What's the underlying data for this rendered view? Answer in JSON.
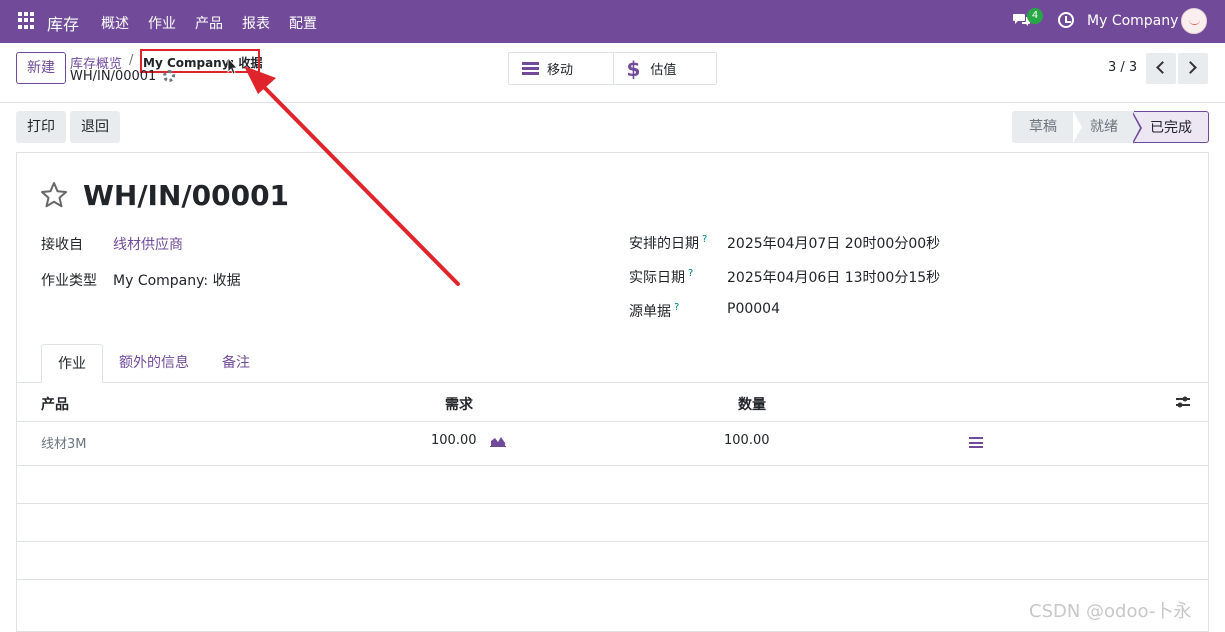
{
  "navbar": {
    "app_name": "库存",
    "menu": [
      "概述",
      "作业",
      "产品",
      "报表",
      "配置"
    ],
    "chat_badge": "4",
    "company": "My Company"
  },
  "control": {
    "new_label": "新建",
    "breadcrumb_parent": "库存概览",
    "breadcrumb_sep": "/",
    "breadcrumb_current": "My Company: 收据",
    "record_name": "WH/IN/00001",
    "smart_buttons": [
      {
        "label": "移动",
        "icon": "menu-lines-icon"
      },
      {
        "label": "估值",
        "icon": "dollar-icon"
      }
    ],
    "pager": "3 / 3"
  },
  "actions": {
    "print_label": "打印",
    "return_label": "退回"
  },
  "statusbar": {
    "stages": [
      "草稿",
      "就绪",
      "已完成"
    ],
    "active": "已完成"
  },
  "form": {
    "title": "WH/IN/00001",
    "fields_left": [
      {
        "label": "接收自",
        "value": "线材供应商"
      },
      {
        "label": "作业类型",
        "value": "My Company: 收据"
      }
    ],
    "fields_right": [
      {
        "label": "安排的日期",
        "help": "?",
        "value": "2025年04月07日 20时00分00秒"
      },
      {
        "label": "实际日期",
        "help": "?",
        "value": "2025年04月06日 13时00分15秒"
      },
      {
        "label": "源单据",
        "help": "?",
        "value": "P00004"
      }
    ]
  },
  "tabs": [
    "作业",
    "额外的信息",
    "备注"
  ],
  "table": {
    "headers": [
      "产品",
      "需求",
      "数量"
    ],
    "rows": [
      {
        "product": "线材3M",
        "demand": "100.00",
        "quantity": "100.00"
      }
    ]
  },
  "watermark": "CSDN @odoo-卜永",
  "colors": {
    "brand": "#714b9a",
    "annotation": "#e0242b"
  }
}
